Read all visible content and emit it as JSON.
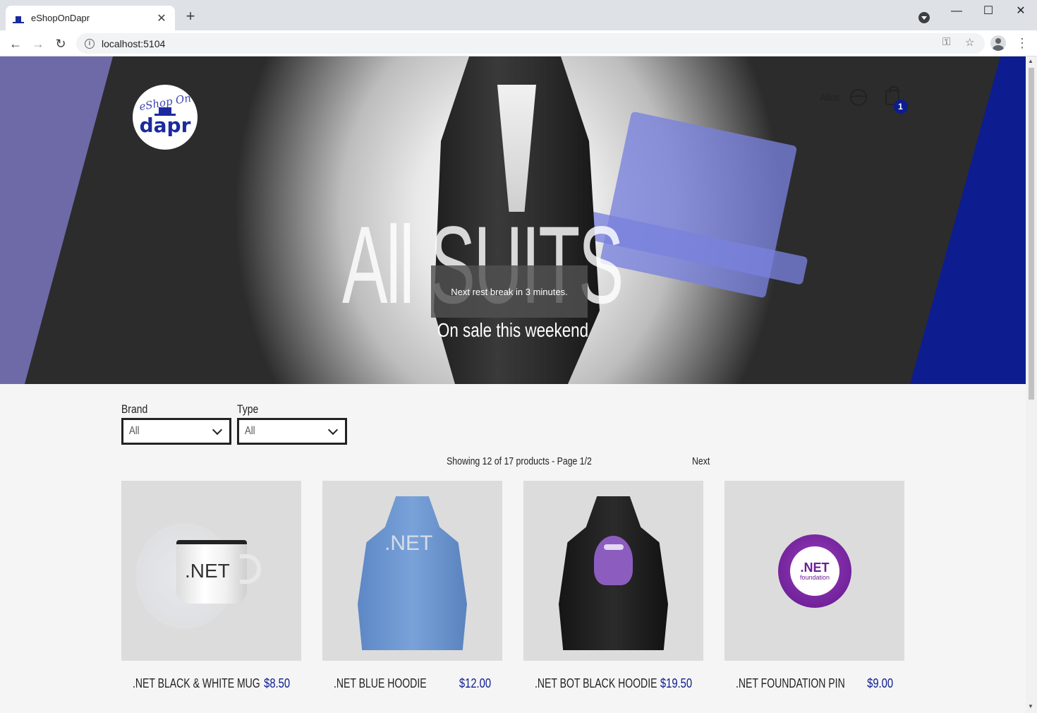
{
  "browser": {
    "tab_title": "eShopOnDapr",
    "url": "localhost:5104"
  },
  "header": {
    "logo_top": "eShop On",
    "logo_bottom": "dapr",
    "user_name": "Alice",
    "cart_count": "1"
  },
  "hero": {
    "title": "All SUITS",
    "subtitle": "On sale this weekend",
    "toast": "Next rest break in 3 minutes."
  },
  "filters": {
    "brand_label": "Brand",
    "brand_value": "All",
    "type_label": "Type",
    "type_value": "All"
  },
  "pager": {
    "info": "Showing 12 of 17 products - Page 1/2",
    "next": "Next"
  },
  "products": [
    {
      "name": ".NET BLACK & WHITE MUG",
      "price": "$8.50"
    },
    {
      "name": ".NET BLUE HOODIE",
      "price": "$12.00"
    },
    {
      "name": ".NET BOT BLACK HOODIE",
      "price": "$19.50"
    },
    {
      "name": ".NET FOUNDATION PIN",
      "price": "$9.00"
    }
  ],
  "product_art": {
    "mug_text": ".NET",
    "blue_hoodie_text": ".NET",
    "pin_text": ".NET",
    "pin_subtext": "foundation"
  },
  "colors": {
    "accent": "#0d1d8f",
    "hero_left": "#6e6aa7",
    "price": "#0d1d8f"
  }
}
